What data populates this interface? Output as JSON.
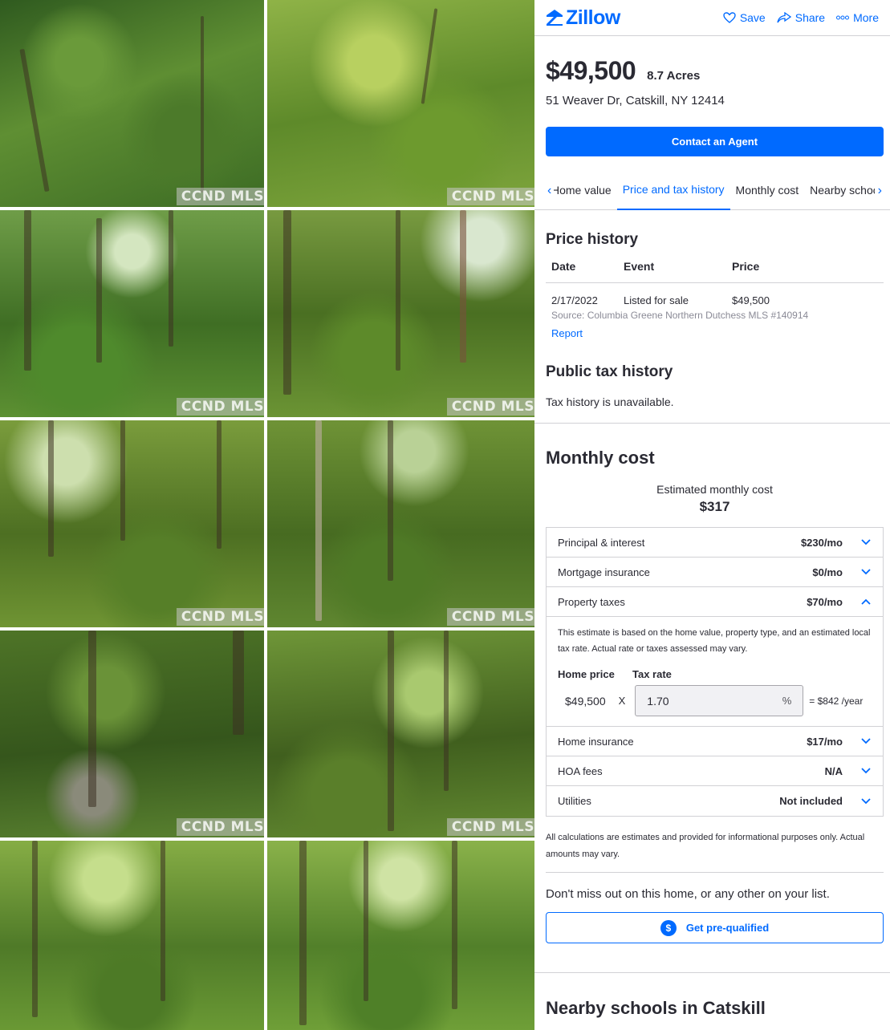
{
  "gallery": {
    "watermark": "CCND MLS",
    "photos": 10
  },
  "header": {
    "logo_text": "Zillow",
    "save_label": "Save",
    "share_label": "Share",
    "more_label": "More"
  },
  "listing": {
    "price": "$49,500",
    "acres": "8.7 Acres",
    "address": "51 Weaver Dr, Catskill, NY 12414",
    "contact_label": "Contact an Agent"
  },
  "tabs": [
    {
      "label": "Home value"
    },
    {
      "label": "Price and tax history"
    },
    {
      "label": "Monthly cost"
    },
    {
      "label": "Nearby schools"
    }
  ],
  "price_history": {
    "title": "Price history",
    "columns": [
      "Date",
      "Event",
      "Price"
    ],
    "rows": [
      {
        "date": "2/17/2022",
        "event": "Listed for sale",
        "price": "$49,500"
      }
    ],
    "source": "Source: Columbia Greene Northern Dutchess MLS #140914",
    "report_label": "Report"
  },
  "tax_history": {
    "title": "Public tax history",
    "message": "Tax history is unavailable."
  },
  "monthly": {
    "title": "Monthly cost",
    "est_label": "Estimated monthly cost",
    "est_value": "$317",
    "rows": [
      {
        "label": "Principal & interest",
        "amount": "$230/mo"
      },
      {
        "label": "Mortgage insurance",
        "amount": "$0/mo"
      },
      {
        "label": "Property taxes",
        "amount": "$70/mo"
      },
      {
        "label": "Home insurance",
        "amount": "$17/mo"
      },
      {
        "label": "HOA fees",
        "amount": "N/A"
      },
      {
        "label": "Utilities",
        "amount": "Not included"
      }
    ],
    "tax_note": "This estimate is based on the home value, property type, and an estimated local tax rate. Actual rate or taxes assessed may vary.",
    "home_price_label": "Home price",
    "tax_rate_label": "Tax rate",
    "home_price_value": "$49,500",
    "times": "X",
    "tax_rate_value": "1.70",
    "pct": "%",
    "yearly": "= $842 /year",
    "disclaimer": "All calculations are estimates and provided for informational purposes only. Actual amounts may vary."
  },
  "prequal": {
    "message": "Don't miss out on this home, or any other on your list.",
    "button_label": "Get pre-qualified",
    "dollar": "$"
  },
  "schools": {
    "title": "Nearby schools in Catskill"
  },
  "colors": {
    "accent": "#006aff",
    "text": "#2a2a33",
    "border": "#d1d1d5"
  }
}
